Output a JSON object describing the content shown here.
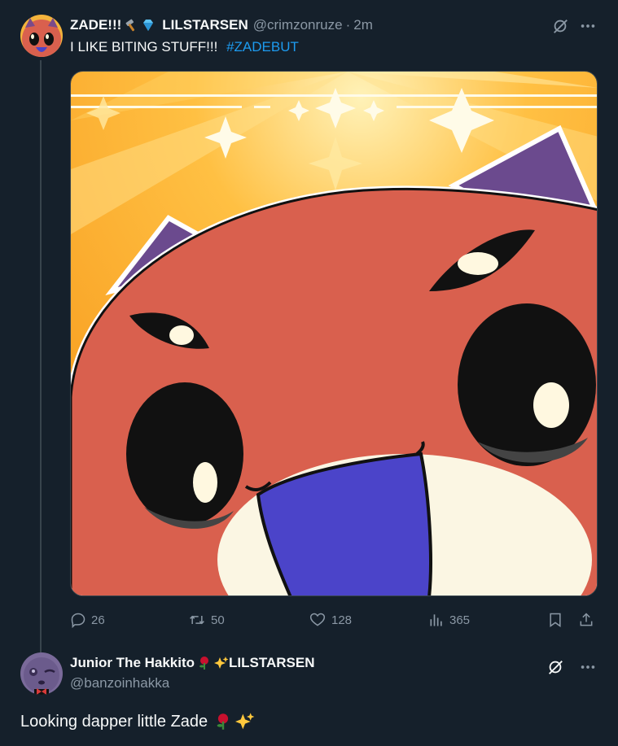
{
  "tweet": {
    "author_name": "ZADE!!!",
    "author_suffix": "LILSTARSEN",
    "handle": "@crimzonruze",
    "separator": "·",
    "time": "2m",
    "text": "I LIKE BITING STUFF!!!",
    "hashtag": "#ZADEBUT",
    "stats": {
      "replies": "26",
      "retweets": "50",
      "likes": "128",
      "views": "365"
    }
  },
  "reply": {
    "author_name": "Junior The Hakkito",
    "author_suffix": "LILSTARSEN",
    "handle": "@banzoinhakka",
    "text": "Looking dapper little Zade"
  },
  "icons": {
    "header_badges": [
      "hammer-icon",
      "gem-icon"
    ],
    "reply_badges": [
      "rose-icon",
      "sparkles-icon"
    ],
    "actions": [
      "reply-icon",
      "retweet-icon",
      "like-icon",
      "views-icon",
      "bookmark-icon",
      "share-icon"
    ],
    "menu": [
      "grok-icon",
      "more-icon"
    ]
  },
  "colors": {
    "background": "#15202b",
    "text": "#f7f9f9",
    "muted": "#8b98a5",
    "link": "#1d9bf0",
    "divider": "#38444d"
  }
}
